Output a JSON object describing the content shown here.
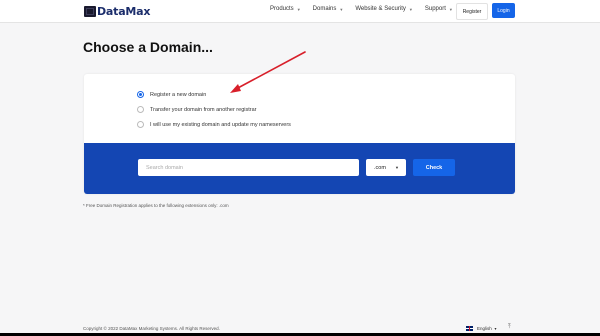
{
  "header": {
    "logo_text": "DataMax",
    "nav": [
      {
        "label": "Products"
      },
      {
        "label": "Domains"
      },
      {
        "label": "Website & Security"
      },
      {
        "label": "Support"
      }
    ],
    "register_label": "Register",
    "login_label": "Login"
  },
  "page_title": "Choose a Domain...",
  "options": [
    {
      "label": "Register a new domain",
      "selected": true
    },
    {
      "label": "Transfer your domain from another registrar",
      "selected": false
    },
    {
      "label": "I will use my existing domain and update my nameservers",
      "selected": false
    }
  ],
  "search": {
    "placeholder": "Search domain",
    "tld_value": ".com",
    "check_label": "Check"
  },
  "note": "* Free Domain Registration applies to the following extensions only: .com",
  "footer": {
    "copyright": "Copyright © 2022 DataMax Marketing Systems. All Rights Reserved.",
    "language": "English"
  },
  "colors": {
    "accent": "#1565e8",
    "panel": "#1446b3",
    "annotation_arrow": "#d81f2a"
  },
  "icons": {
    "logo": "logo-icon",
    "caret": "chevron-down-icon",
    "flag": "uk-flag-icon",
    "scroll_top": "arrow-up-icon"
  }
}
